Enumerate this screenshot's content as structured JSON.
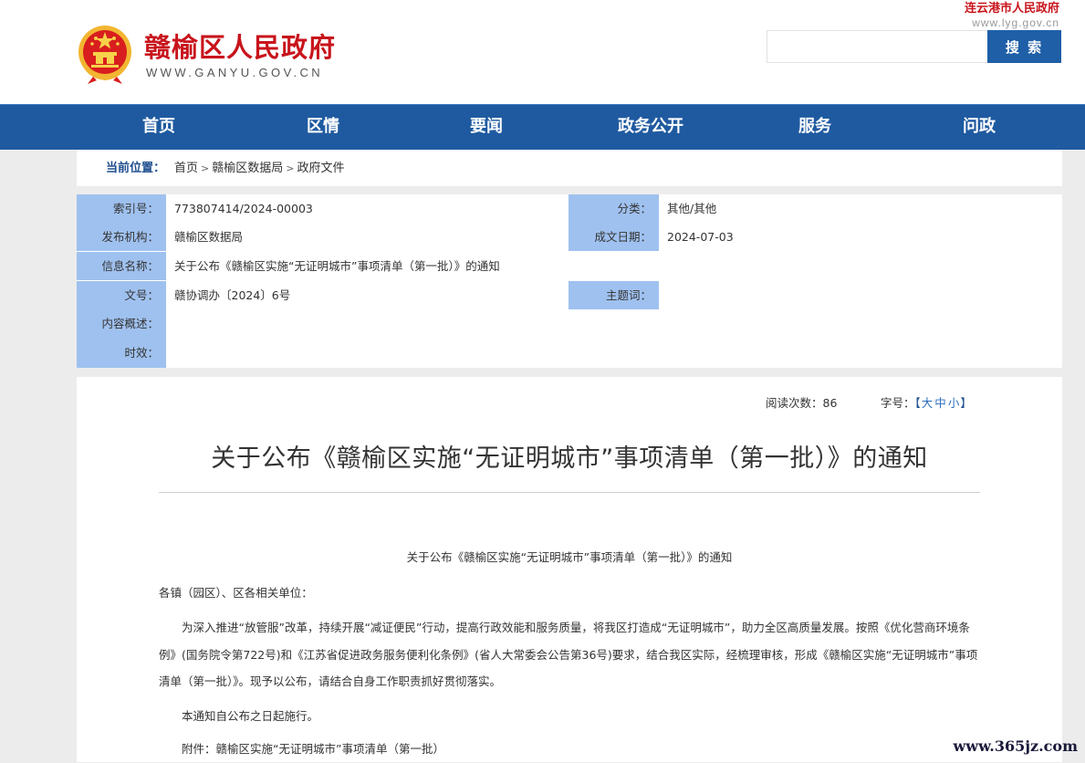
{
  "header": {
    "site_name": "赣榆区人民政府",
    "site_domain": "WWW.GANYU.GOV.CN",
    "parent_site_name": "连云港市人民政府",
    "parent_site_domain": "www.lyg.gov.cn",
    "search_placeholder": "",
    "search_button": "搜 索"
  },
  "nav": {
    "items": [
      {
        "label": "首页"
      },
      {
        "label": "区情"
      },
      {
        "label": "要闻"
      },
      {
        "label": "政务公开"
      },
      {
        "label": "服务"
      },
      {
        "label": "问政"
      }
    ]
  },
  "breadcrumb": {
    "label": "当前位置：",
    "items": [
      "首页",
      "赣榆区数据局",
      "政府文件"
    ]
  },
  "meta": {
    "index_no_label": "索引号：",
    "index_no": "773807414/2024-00003",
    "category_label": "分类：",
    "category": "其他/其他",
    "publisher_label": "发布机构：",
    "publisher": "赣榆区数据局",
    "date_label": "成文日期：",
    "date": "2024-07-03",
    "info_name_label": "信息名称：",
    "info_name": "关于公布《赣榆区实施“无证明城市”事项清单（第一批）》的通知",
    "doc_no_label": "文号：",
    "doc_no": "赣协调办〔2024〕6号",
    "keywords_label": "主题词：",
    "summary_label": "内容概述：",
    "validity_label": "时效："
  },
  "article": {
    "views_label": "阅读次数：",
    "views": "86",
    "font_size_label": "字号：",
    "font_size_open": "【",
    "font_size_large": "大",
    "font_size_medium": "中",
    "font_size_small": "小",
    "font_size_close": "】",
    "title": "关于公布《赣榆区实施“无证明城市”事项清单（第一批）》的通知",
    "body_heading": "关于公布《赣榆区实施“无证明城市”事项清单（第一批）》的通知",
    "salutation": "各镇（园区）、区各相关单位：",
    "paragraph1": "为深入推进“放管服”改革，持续开展“减证便民”行动，提高行政效能和服务质量，将我区打造成“无证明城市”，助力全区高质量发展。按照《优化营商环境条例》(国务院令第722号)和《江苏省促进政务服务便利化条例》(省人大常委会公告第36号)要求，结合我区实际，经梳理审核，形成《赣榆区实施“无证明城市”事项清单（第一批）》。现予以公布，请结合自身工作职责抓好贯彻落实。",
    "paragraph2": "本通知自公布之日起施行。",
    "attachment": "附件：赣榆区实施“无证明城市”事项清单（第一批）"
  },
  "watermark": "www.365jz.com",
  "colors": {
    "nav_blue": "#1f5aa0",
    "brand_red": "#c8141c",
    "label_blue": "#9fc1ef",
    "search_blue": "#1e5fa8"
  }
}
